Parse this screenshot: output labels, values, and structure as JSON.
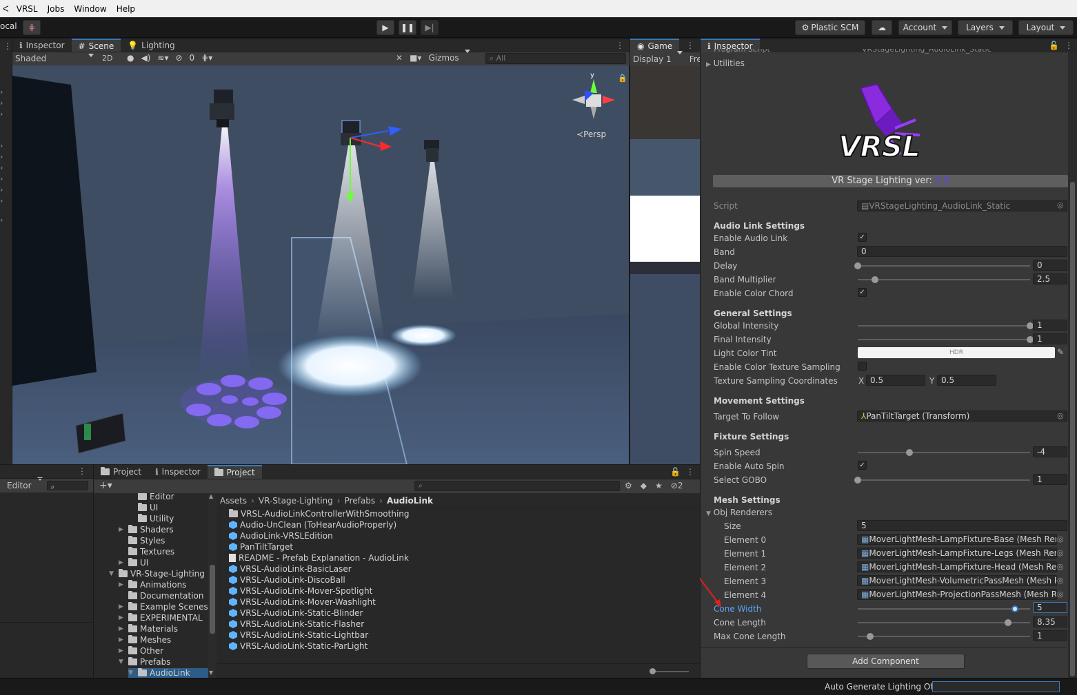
{
  "menu": [
    "VRSL",
    "Jobs",
    "Window",
    "Help"
  ],
  "toolbar": {
    "local_label": "ocal",
    "plastic_scm": "Plastic SCM",
    "account": "Account",
    "layers": "Layers",
    "layout": "Layout"
  },
  "scene_tabs": {
    "inspector": "Inspector",
    "scene": "Scene",
    "lighting": "Lighting"
  },
  "scene_toolbar": {
    "shaded": "Shaded",
    "twod": "2D",
    "hidden_count": "0",
    "gizmos": "Gizmos",
    "search_placeholder": "All"
  },
  "scene_overlay": {
    "gizmo_y": "y",
    "persp": "Persp"
  },
  "game_tab": {
    "label": "Game",
    "display": "Display 1",
    "free": "Fre"
  },
  "inspector": {
    "tab_label": "Inspector",
    "partial_top": "Program Script",
    "partial_top_value": "VRStageLighting_AudioLink_Static",
    "utilities": "Utilities",
    "banner_version_prefix": "VR Stage Lighting ver: ",
    "banner_version": "2.0",
    "logo_text": "VRSL",
    "script_label": "Script",
    "script_value": "VRStageLighting_AudioLink_Static",
    "audio_link_header": "Audio Link Settings",
    "enable_audio_link": "Enable Audio Link",
    "band": "Band",
    "band_value": "0",
    "delay": "Delay",
    "delay_value": "0",
    "band_multiplier": "Band Multiplier",
    "band_multiplier_value": "2.5",
    "enable_color_chord": "Enable Color Chord",
    "general_header": "General Settings",
    "global_intensity": "Global Intensity",
    "global_intensity_value": "1",
    "final_intensity": "Final Intensity",
    "final_intensity_value": "1",
    "light_color_tint": "Light Color Tint",
    "hdr_label": "HDR",
    "enable_color_texture": "Enable Color Texture Sampling",
    "texture_coords": "Texture Sampling Coordinates",
    "x_label": "X",
    "x_value": "0.5",
    "y_label": "Y",
    "y_value": "0.5",
    "movement_header": "Movement Settings",
    "target_to_follow": "Target To Follow",
    "target_value": "PanTiltTarget (Transform)",
    "fixture_header": "Fixture Settings",
    "spin_speed": "Spin Speed",
    "spin_speed_value": "-4",
    "enable_auto_spin": "Enable Auto Spin",
    "select_gobo": "Select GOBO",
    "select_gobo_value": "1",
    "mesh_header": "Mesh Settings",
    "obj_renderers": "Obj Renderers",
    "size": "Size",
    "size_value": "5",
    "elements": [
      {
        "label": "Element 0",
        "value": "MoverLightMesh-LampFixture-Base (Mesh Renc"
      },
      {
        "label": "Element 1",
        "value": "MoverLightMesh-LampFixture-Legs (Mesh Renc"
      },
      {
        "label": "Element 2",
        "value": "MoverLightMesh-LampFixture-Head (Mesh Ren"
      },
      {
        "label": "Element 3",
        "value": "MoverLightMesh-VolumetricPassMesh (Mesh Re"
      },
      {
        "label": "Element 4",
        "value": "MoverLightMesh-ProjectionPassMesh (Mesh Re"
      }
    ],
    "cone_width": "Cone Width",
    "cone_width_value": "5",
    "cone_length": "Cone Length",
    "cone_length_value": "8.35",
    "max_cone_length": "Max Cone Length",
    "max_cone_length_value": "1",
    "add_component": "Add Component",
    "sliders": {
      "delay": 0.0,
      "band_multiplier": 0.1,
      "global_intensity": 1.0,
      "final_intensity": 1.0,
      "spin_speed": 0.3,
      "select_gobo": 0.0,
      "cone_width": 0.91,
      "cone_length": 0.87,
      "max_cone_length": 0.07
    }
  },
  "bottom_left": {
    "editor": "Editor"
  },
  "project": {
    "tabs": [
      "Project",
      "Inspector",
      "Project"
    ],
    "hidden_count": "2",
    "breadcrumb": [
      "Assets",
      "VR-Stage-Lighting",
      "Prefabs",
      "AudioLink"
    ],
    "tree": [
      {
        "label": "Editor",
        "indent": 2,
        "arrow": ""
      },
      {
        "label": "UI",
        "indent": 2,
        "arrow": ""
      },
      {
        "label": "Utility",
        "indent": 2,
        "arrow": ""
      },
      {
        "label": "Shaders",
        "indent": 1,
        "arrow": "▶"
      },
      {
        "label": "Styles",
        "indent": 1,
        "arrow": ""
      },
      {
        "label": "Textures",
        "indent": 1,
        "arrow": ""
      },
      {
        "label": "UI",
        "indent": 1,
        "arrow": "▶"
      },
      {
        "label": "VR-Stage-Lighting",
        "indent": 0,
        "arrow": "▼"
      },
      {
        "label": "Animations",
        "indent": 1,
        "arrow": "▶"
      },
      {
        "label": "Documentation",
        "indent": 1,
        "arrow": ""
      },
      {
        "label": "Example Scenes",
        "indent": 1,
        "arrow": "▶"
      },
      {
        "label": "EXPERIMENTAL",
        "indent": 1,
        "arrow": "▶"
      },
      {
        "label": "Materials",
        "indent": 1,
        "arrow": "▶"
      },
      {
        "label": "Meshes",
        "indent": 1,
        "arrow": "▶"
      },
      {
        "label": "Other",
        "indent": 1,
        "arrow": "▶"
      },
      {
        "label": "Prefabs",
        "indent": 1,
        "arrow": "▼"
      },
      {
        "label": "AudioLink",
        "indent": 2,
        "arrow": "▼"
      }
    ],
    "files": [
      {
        "label": "VRSL-AudioLinkControllerWithSmoothing",
        "kind": "folder"
      },
      {
        "label": "Audio-UnClean (ToHearAudioProperly)",
        "kind": "prefab"
      },
      {
        "label": "AudioLink-VRSLEdition",
        "kind": "prefab"
      },
      {
        "label": "PanTiltTarget",
        "kind": "prefab"
      },
      {
        "label": "README - Prefab Explanation - AudioLink",
        "kind": "doc"
      },
      {
        "label": "VRSL-AudioLink-BasicLaser",
        "kind": "prefab"
      },
      {
        "label": "VRSL-AudioLink-DiscoBall",
        "kind": "prefab"
      },
      {
        "label": "VRSL-AudioLink-Mover-Spotlight",
        "kind": "prefab"
      },
      {
        "label": "VRSL-AudioLink-Mover-Washlight",
        "kind": "prefab"
      },
      {
        "label": "VRSL-AudioLink-Static-Blinder",
        "kind": "prefab"
      },
      {
        "label": "VRSL-AudioLink-Static-Flasher",
        "kind": "prefab"
      },
      {
        "label": "VRSL-AudioLink-Static-Lightbar",
        "kind": "prefab"
      },
      {
        "label": "VRSL-AudioLink-Static-ParLight",
        "kind": "prefab"
      }
    ]
  },
  "statusbar": {
    "auto_generate": "Auto Generate Lighting Off"
  },
  "colors": {
    "accent": "#3a79bb",
    "version": "#6b3cff",
    "cone_width_label": "#5aa6ff"
  }
}
